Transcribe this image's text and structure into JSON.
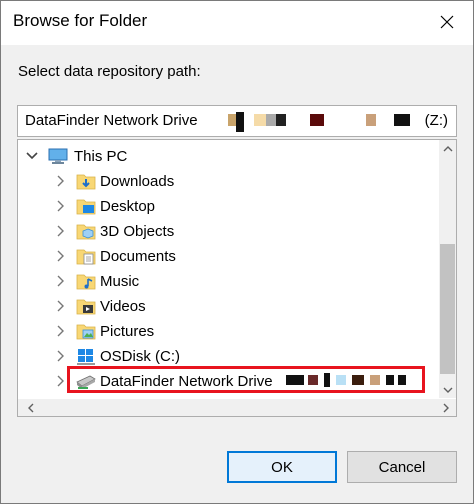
{
  "dialog": {
    "title": "Browse for Folder",
    "prompt": "Select data repository path:"
  },
  "path": {
    "value": "DataFinder Network Drive",
    "drive": "(Z:)"
  },
  "tree": {
    "items": [
      {
        "label": "This PC",
        "icon": "this-pc-icon"
      },
      {
        "label": "Downloads",
        "icon": "downloads-folder-icon"
      },
      {
        "label": "Desktop",
        "icon": "desktop-folder-icon"
      },
      {
        "label": "3D Objects",
        "icon": "3d-objects-folder-icon"
      },
      {
        "label": "Documents",
        "icon": "documents-folder-icon"
      },
      {
        "label": "Music",
        "icon": "music-folder-icon"
      },
      {
        "label": "Videos",
        "icon": "videos-folder-icon"
      },
      {
        "label": "Pictures",
        "icon": "pictures-folder-icon"
      },
      {
        "label": "OSDisk (C:)",
        "icon": "windows-drive-icon"
      },
      {
        "label": "DataFinder Network Drive",
        "icon": "network-drive-icon"
      }
    ]
  },
  "buttons": {
    "ok": "OK",
    "cancel": "Cancel"
  },
  "colors": {
    "highlight": "#e8141e",
    "accent": "#0078d7",
    "folder": "#f8d775"
  }
}
